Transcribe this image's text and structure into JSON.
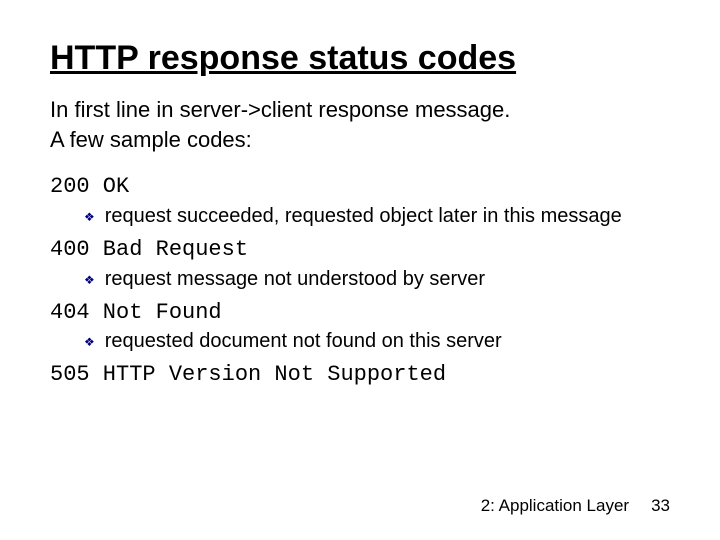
{
  "title": "HTTP response status codes",
  "intro_line1": "In first line in server->client response message.",
  "intro_line2": "A few sample codes:",
  "codes": [
    {
      "code": "200 OK",
      "desc": "request succeeded, requested object later in this message"
    },
    {
      "code": "400 Bad Request",
      "desc": "request message not understood by server"
    },
    {
      "code": "404 Not Found",
      "desc": "requested document not found on this server"
    },
    {
      "code": "505 HTTP Version Not Supported",
      "desc": ""
    }
  ],
  "footer": {
    "chapter": "2: Application Layer",
    "page": "33"
  },
  "bullet_glyph": "❖"
}
